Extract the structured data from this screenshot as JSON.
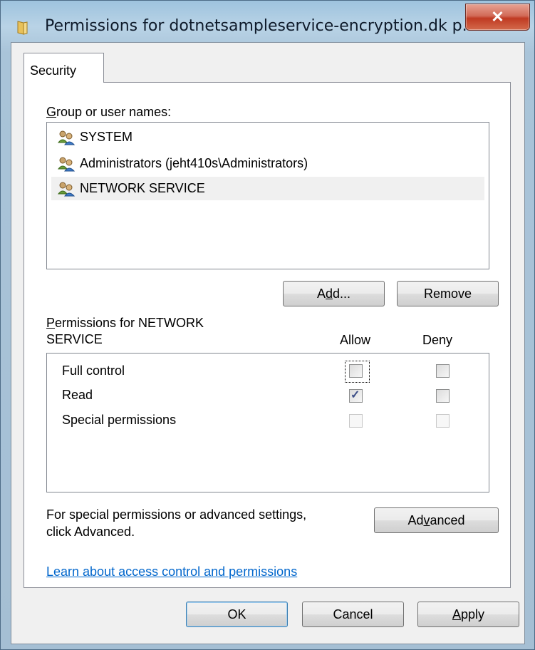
{
  "window": {
    "title": "Permissions for dotnetsampleservice-encryption.dk p...",
    "close_label": "✕"
  },
  "tabs": [
    {
      "label": "Security",
      "selected": true
    }
  ],
  "groups": {
    "label_first": "G",
    "label_rest": "roup or user names:",
    "items": [
      {
        "name": "SYSTEM",
        "selected": false
      },
      {
        "name": "Administrators (jeht410s\\Administrators)",
        "selected": false
      },
      {
        "name": "NETWORK SERVICE",
        "selected": true
      }
    ],
    "add_pre": "A",
    "add_u": "d",
    "add_post": "d...",
    "remove_label": "Remove"
  },
  "permissions": {
    "heading_first": "P",
    "heading_line1_rest": "ermissions for NETWORK",
    "heading_line2": "SERVICE",
    "allow_header": "Allow",
    "deny_header": "Deny",
    "rows": [
      {
        "name": "Full control",
        "allow": false,
        "deny": false,
        "enabled": true
      },
      {
        "name": "Read",
        "allow": true,
        "deny": false,
        "enabled": true
      },
      {
        "name": "Special permissions",
        "allow": false,
        "deny": false,
        "enabled": false
      }
    ]
  },
  "advanced": {
    "text_line1": "For special permissions or advanced settings,",
    "text_line2": "click Advanced.",
    "button_pre": "Ad",
    "button_u": "v",
    "button_post": "anced"
  },
  "link": {
    "label": "Learn about access control and permissions"
  },
  "footer": {
    "ok_label": "OK",
    "cancel_label": "Cancel",
    "apply_u": "A",
    "apply_rest": "pply"
  },
  "colors": {
    "link": "#0066cc",
    "close_button": "#c03a22",
    "selection": "#f0f0f0"
  }
}
